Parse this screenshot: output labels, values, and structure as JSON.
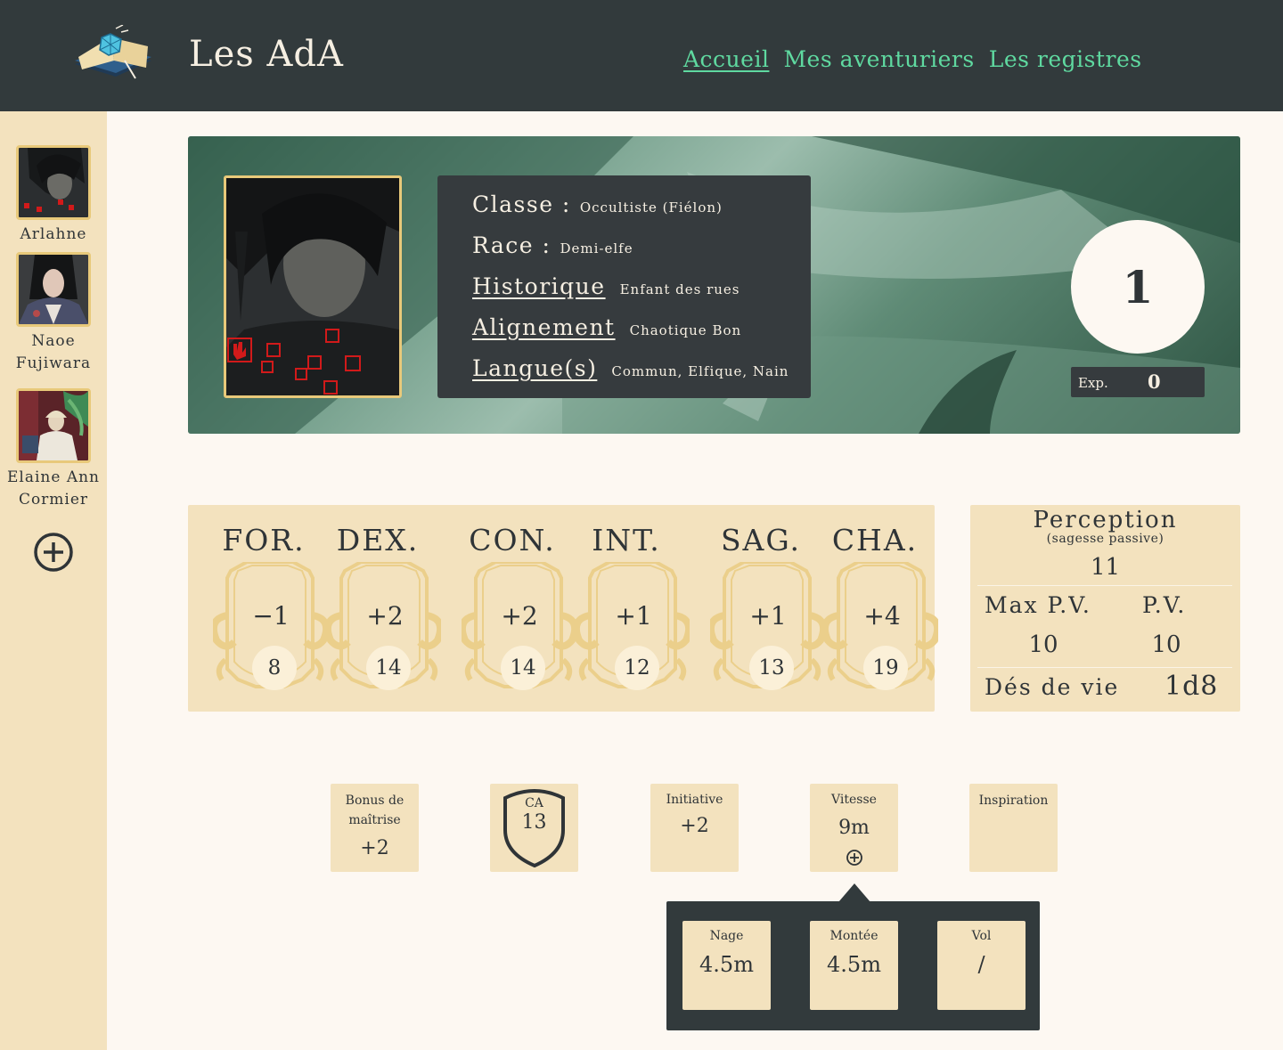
{
  "header": {
    "app_title": "Les AdA",
    "nav": [
      {
        "label": "Accueil"
      },
      {
        "label": "Mes aventuriers"
      },
      {
        "label": "Les registres"
      }
    ]
  },
  "sidebar": {
    "characters": [
      {
        "name": "Arlahne"
      },
      {
        "name": "Naoe Fujiwara"
      },
      {
        "name": "Elaine Ann Cormier"
      }
    ],
    "add_icon": "plus-circle-icon"
  },
  "character": {
    "info": [
      {
        "label": "Classe :",
        "value": "Occultiste (Fiélon)"
      },
      {
        "label": "Race :",
        "value": "Demi-elfe"
      },
      {
        "label": "Historique",
        "value": "Enfant des rues"
      },
      {
        "label": "Alignement",
        "value": "Chaotique Bon"
      },
      {
        "label": "Langue(s)",
        "value": "Commun, Elfique, Nain"
      }
    ],
    "level": "1",
    "exp_label": "Exp.",
    "exp_value": "0"
  },
  "abilities": [
    {
      "abbr": "FOR.",
      "mod": "−1",
      "score": "8"
    },
    {
      "abbr": "DEX.",
      "mod": "+2",
      "score": "14"
    },
    {
      "abbr": "CON.",
      "mod": "+2",
      "score": "14"
    },
    {
      "abbr": "INT.",
      "mod": "+1",
      "score": "12"
    },
    {
      "abbr": "SAG.",
      "mod": "+1",
      "score": "13"
    },
    {
      "abbr": "CHA.",
      "mod": "+4",
      "score": "19"
    }
  ],
  "vitals": {
    "perception_title": "Perception",
    "perception_sub": "(sagesse passive)",
    "perception_value": "11",
    "max_pv_label": "Max P.V.",
    "pv_label": "P.V.",
    "max_pv_value": "10",
    "pv_value": "10",
    "hit_dice_label": "Dés de vie",
    "hit_dice_value": "1d8"
  },
  "stats": {
    "proficiency_label_1": "Bonus de",
    "proficiency_label_2": "maîtrise",
    "proficiency_value": "+2",
    "ac_label": "CA",
    "ac_value": "13",
    "initiative_label": "Initiative",
    "initiative_value": "+2",
    "speed_label": "Vitesse",
    "speed_value": "9m",
    "inspiration_label": "Inspiration"
  },
  "speed_popup": [
    {
      "label": "Nage",
      "value": "4.5m"
    },
    {
      "label": "Montée",
      "value": "4.5m"
    },
    {
      "label": "Vol",
      "value": "/"
    }
  ],
  "colors": {
    "header_bg": "#323a3c",
    "accent_green": "#5fd9a0",
    "parchment": "#f3e2be",
    "page_bg": "#fdf8f2",
    "gold_frame": "#e8c97a"
  }
}
